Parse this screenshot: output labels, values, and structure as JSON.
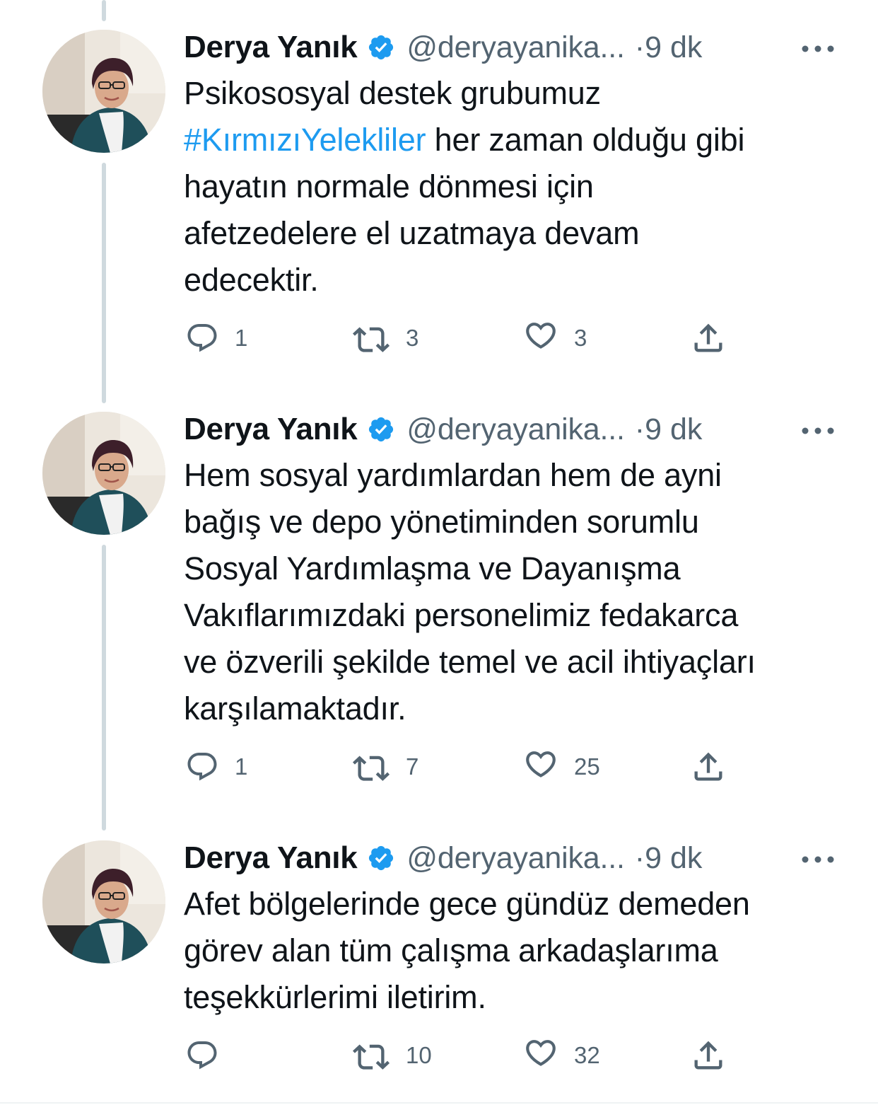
{
  "tweets": [
    {
      "author_name": "Derya Yanık",
      "handle": "@deryayanika...",
      "time": "·9 dk",
      "text_lines": [
        {
          "text": "Psikososyal destek grubumuz"
        },
        {
          "hashtag": "#KırmızıYelekliler",
          "text": " her zaman olduğu gibi"
        },
        {
          "text": "hayatın normale dönmesi için"
        },
        {
          "text": "afetzedelere el uzatmaya devam"
        },
        {
          "text": "edecektir."
        }
      ],
      "replies": "1",
      "retweets": "3",
      "likes": "3"
    },
    {
      "author_name": "Derya Yanık",
      "handle": "@deryayanika...",
      "time": "·9 dk",
      "text_lines": [
        {
          "text": "Hem sosyal yardımlardan hem de ayni"
        },
        {
          "text": "bağış ve depo yönetiminden sorumlu"
        },
        {
          "text": "Sosyal Yardımlaşma ve Dayanışma"
        },
        {
          "text": "Vakıflarımızdaki personelimiz fedakarca"
        },
        {
          "text": "ve özverili şekilde temel ve acil ihtiyaçları"
        },
        {
          "text": "karşılamaktadır."
        }
      ],
      "replies": "1",
      "retweets": "7",
      "likes": "25"
    },
    {
      "author_name": "Derya Yanık",
      "handle": "@deryayanika...",
      "time": "·9 dk",
      "text_lines": [
        {
          "text": "Afet bölgelerinde gece gündüz demeden"
        },
        {
          "text": "görev alan tüm çalışma arkadaşlarıma"
        },
        {
          "text": "teşekkürlerimi iletirim."
        }
      ],
      "replies": "",
      "retweets": "10",
      "likes": "32"
    }
  ],
  "colors": {
    "text_primary": "#0f1419",
    "text_secondary": "#536471",
    "accent": "#1d9bf0",
    "thread_line": "#cfd9de"
  },
  "icons": {
    "verified": "verified-badge-icon",
    "more": "more-horizontal-icon",
    "reply": "reply-icon",
    "retweet": "retweet-icon",
    "like": "heart-icon",
    "share": "share-icon"
  }
}
